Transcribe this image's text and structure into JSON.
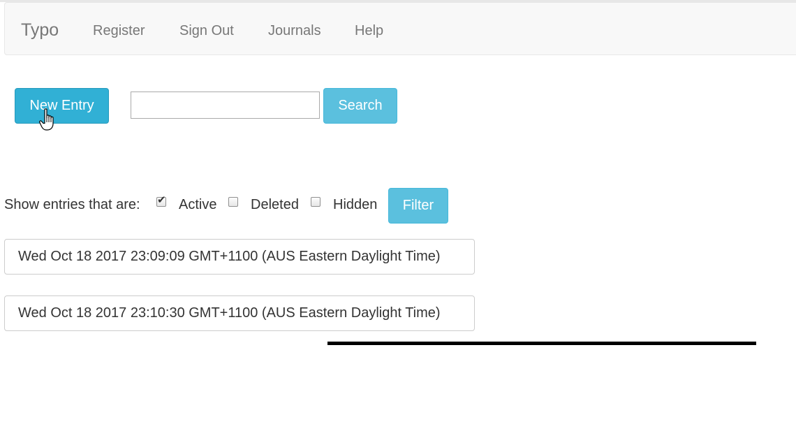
{
  "navbar": {
    "brand": "Typo",
    "items": [
      {
        "label": "Register"
      },
      {
        "label": "Sign Out"
      },
      {
        "label": "Journals"
      },
      {
        "label": "Help"
      }
    ]
  },
  "toolbar": {
    "new_entry_label": "New Entry",
    "search_value": "",
    "search_placeholder": "",
    "search_label": "Search"
  },
  "filter": {
    "prompt": "Show entries that are:",
    "options": [
      {
        "label": "Active",
        "checked": true
      },
      {
        "label": "Deleted",
        "checked": false
      },
      {
        "label": "Hidden",
        "checked": false
      }
    ],
    "button_label": "Filter"
  },
  "entries": [
    {
      "title": "Wed Oct 18 2017 23:09:09 GMT+1100 (AUS Eastern Daylight Time)"
    },
    {
      "title": "Wed Oct 18 2017 23:10:30 GMT+1100 (AUS Eastern Daylight Time)"
    }
  ],
  "icons": {
    "cursor": "hand-pointer-icon",
    "checkmark": "checkmark-icon"
  }
}
